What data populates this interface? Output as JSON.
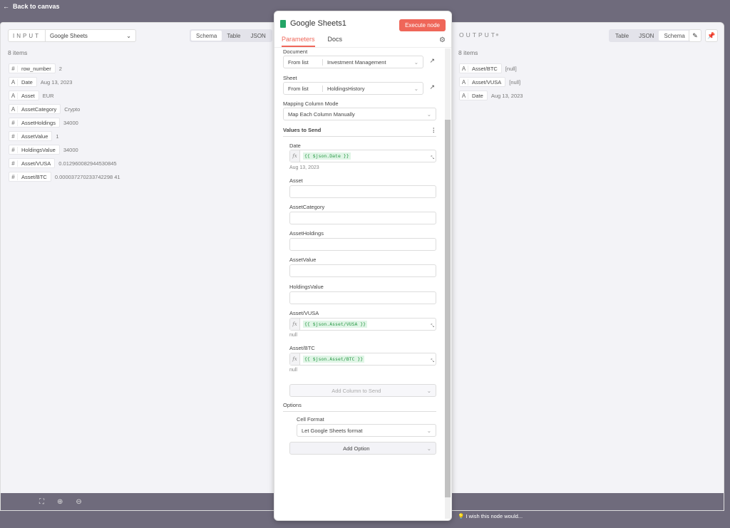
{
  "back": "Back to canvas",
  "input": {
    "label": "INPUT",
    "source": "Google Sheets",
    "views": [
      "Schema",
      "Table",
      "JSON"
    ],
    "active": "Schema",
    "count": "8 items",
    "fields": [
      {
        "type": "#",
        "key": "row_number",
        "value": "2"
      },
      {
        "type": "A",
        "key": "Date",
        "value": "Aug 13, 2023"
      },
      {
        "type": "A",
        "key": "Asset",
        "value": "EUR"
      },
      {
        "type": "A",
        "key": "AssetCategory",
        "value": "Crypto"
      },
      {
        "type": "#",
        "key": "AssetHoldings",
        "value": "34000"
      },
      {
        "type": "#",
        "key": "AssetValue",
        "value": "1"
      },
      {
        "type": "#",
        "key": "HoldingsValue",
        "value": "34000"
      },
      {
        "type": "#",
        "key": "Asset/VUSA",
        "value": "0.012960082944530845"
      },
      {
        "type": "#",
        "key": "Asset/BTC",
        "value": "0.000037270233742298 41"
      }
    ]
  },
  "node": {
    "title": "Google Sheets1",
    "execute": "Execute node",
    "tabs": [
      "Parameters",
      "Docs"
    ],
    "document_label": "Document",
    "from_list": "From list",
    "document": "Investment Management",
    "sheet_label": "Sheet",
    "sheet": "HoldingsHistory",
    "mapping_label": "Mapping Column Mode",
    "mapping": "Map Each Column Manually",
    "values_label": "Values to Send",
    "date_label": "Date",
    "date_expr": "{{ $json.Date }}",
    "date_result": "Aug 13, 2023",
    "asset_label": "Asset",
    "category_label": "AssetCategory",
    "holdings_label": "AssetHoldings",
    "value_label": "AssetValue",
    "hvalue_label": "HoldingsValue",
    "vusa_label": "Asset/VUSA",
    "vusa_expr": "{{ $json.Asset/VUSA }}",
    "vusa_result": "null",
    "btc_label": "Asset/BTC",
    "btc_expr": "{{ $json.Asset/BTC }}",
    "btc_result": "null",
    "add_column": "Add Column to Send",
    "options_label": "Options",
    "cell_format_label": "Cell Format",
    "cell_format": "Let Google Sheets format",
    "add_option": "Add Option"
  },
  "output": {
    "label": "OUTPUT",
    "views": [
      "Table",
      "JSON",
      "Schema"
    ],
    "active": "Schema",
    "count": "8 items",
    "fields": [
      {
        "type": "A",
        "key": "Asset/BTC",
        "value": "[null]"
      },
      {
        "type": "A",
        "key": "Asset/VUSA",
        "value": "[null]"
      },
      {
        "type": "A",
        "key": "Date",
        "value": "Aug 13, 2023"
      }
    ]
  },
  "feedback": "I wish this node would..."
}
